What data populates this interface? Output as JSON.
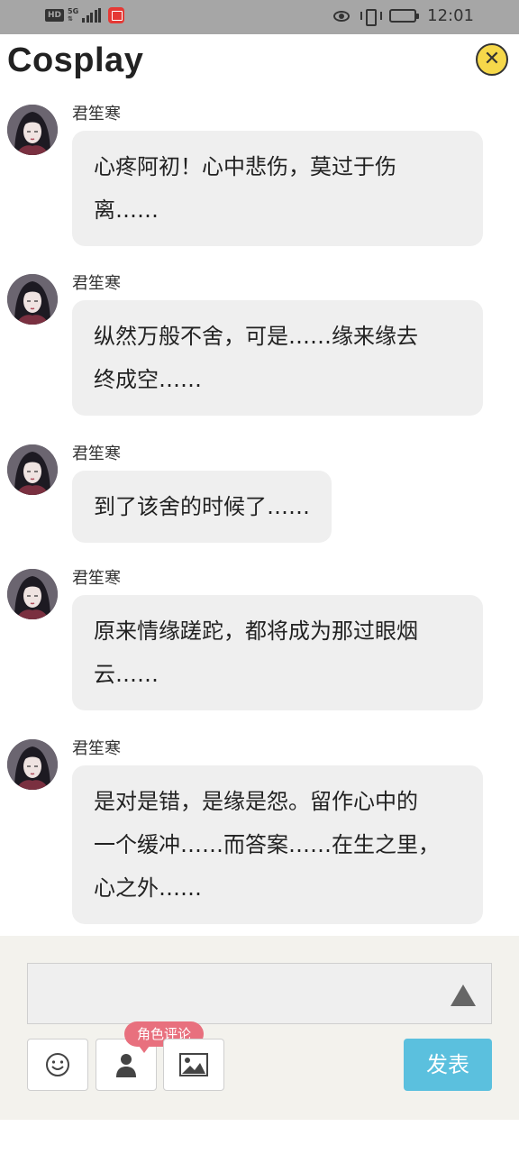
{
  "status_bar": {
    "hd": "HD",
    "network": "5G",
    "time": "12:01",
    "battery_level": 0.2
  },
  "header": {
    "title": "Cosplay",
    "close_icon": "close-circle-icon"
  },
  "messages": [
    {
      "name": "君笙寒",
      "text": "心疼阿初！心中悲伤，莫过于伤\n离……"
    },
    {
      "name": "君笙寒",
      "text": "纵然万般不舍，可是……缘来缘去\n终成空……"
    },
    {
      "name": "君笙寒",
      "text": "到了该舍的时候了……"
    },
    {
      "name": "君笙寒",
      "text": "原来情缘蹉跎，都将成为那过眼烟\n云……"
    },
    {
      "name": "君笙寒",
      "text": "是对是错，是缘是怨。留作心中的\n一个缓冲……而答案……在生之里，\n心之外……"
    }
  ],
  "composer": {
    "input_value": "",
    "role_badge": "角色评论",
    "post_label": "发表",
    "tools": [
      "smiley-icon",
      "person-icon",
      "image-icon"
    ]
  },
  "colors": {
    "post_button": "#5bc0de",
    "role_badge": "#e8707e",
    "close_button": "#f6d84a"
  }
}
